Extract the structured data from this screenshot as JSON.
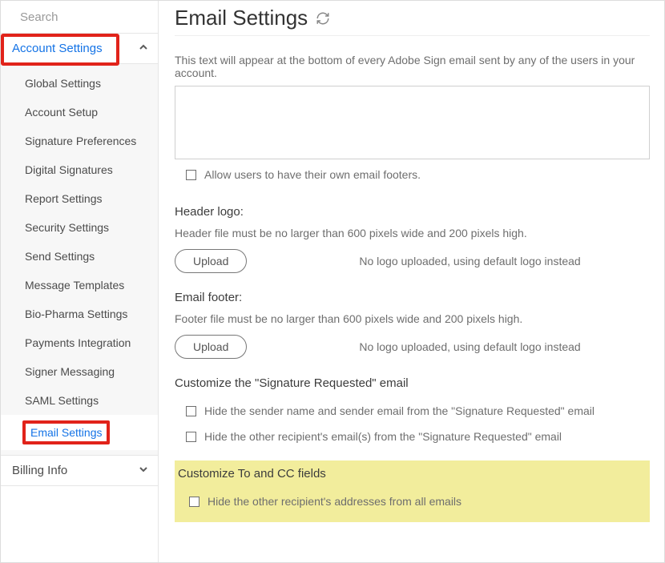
{
  "sidebar": {
    "search_placeholder": "Search",
    "sections": {
      "account": {
        "label": "Account Settings",
        "expanded": true,
        "items": [
          {
            "label": "Global Settings"
          },
          {
            "label": "Account Setup"
          },
          {
            "label": "Signature Preferences"
          },
          {
            "label": "Digital Signatures"
          },
          {
            "label": "Report Settings"
          },
          {
            "label": "Security Settings"
          },
          {
            "label": "Send Settings"
          },
          {
            "label": "Message Templates"
          },
          {
            "label": "Bio-Pharma Settings"
          },
          {
            "label": "Payments Integration"
          },
          {
            "label": "Signer Messaging"
          },
          {
            "label": "SAML Settings"
          },
          {
            "label": "Email Settings"
          }
        ]
      },
      "billing": {
        "label": "Billing Info",
        "expanded": false
      }
    }
  },
  "main": {
    "title": "Email Settings",
    "footer_text_desc": "This text will appear at the bottom of every Adobe Sign email sent by any of the users in your account.",
    "footer_textarea_value": "",
    "allow_own_footers_label": "Allow users to have their own email footers.",
    "header_logo": {
      "heading": "Header logo:",
      "hint": "Header file must be no larger than 600 pixels wide and 200 pixels high.",
      "upload_label": "Upload",
      "status": "No logo uploaded, using default logo instead"
    },
    "email_footer": {
      "heading": "Email footer:",
      "hint": "Footer file must be no larger than 600 pixels wide and 200 pixels high.",
      "upload_label": "Upload",
      "status": "No logo uploaded, using default logo instead"
    },
    "sig_req": {
      "heading": "Customize the \"Signature Requested\" email",
      "opt1": "Hide the sender name and sender email from the \"Signature Requested\" email",
      "opt2": "Hide the other recipient's email(s) from the \"Signature Requested\" email"
    },
    "to_cc": {
      "heading": "Customize To and CC fields",
      "opt1": "Hide the other recipient's addresses from all emails"
    }
  }
}
